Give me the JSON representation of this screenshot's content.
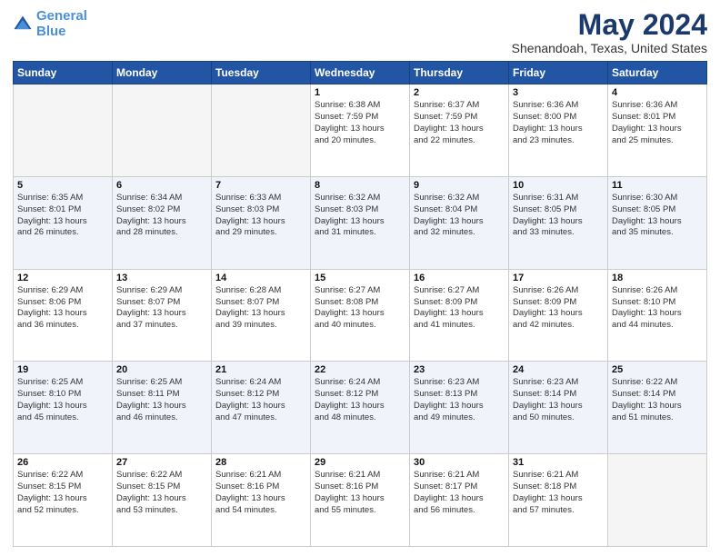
{
  "header": {
    "logo_line1": "General",
    "logo_line2": "Blue",
    "title": "May 2024",
    "subtitle": "Shenandoah, Texas, United States"
  },
  "weekdays": [
    "Sunday",
    "Monday",
    "Tuesday",
    "Wednesday",
    "Thursday",
    "Friday",
    "Saturday"
  ],
  "weeks": [
    [
      {
        "day": "",
        "empty": true
      },
      {
        "day": "",
        "empty": true
      },
      {
        "day": "",
        "empty": true
      },
      {
        "day": "1",
        "sunrise": "6:38 AM",
        "sunset": "7:59 PM",
        "daylight": "13 hours and 20 minutes."
      },
      {
        "day": "2",
        "sunrise": "6:37 AM",
        "sunset": "7:59 PM",
        "daylight": "13 hours and 22 minutes."
      },
      {
        "day": "3",
        "sunrise": "6:36 AM",
        "sunset": "8:00 PM",
        "daylight": "13 hours and 23 minutes."
      },
      {
        "day": "4",
        "sunrise": "6:36 AM",
        "sunset": "8:01 PM",
        "daylight": "13 hours and 25 minutes."
      }
    ],
    [
      {
        "day": "5",
        "sunrise": "6:35 AM",
        "sunset": "8:01 PM",
        "daylight": "13 hours and 26 minutes."
      },
      {
        "day": "6",
        "sunrise": "6:34 AM",
        "sunset": "8:02 PM",
        "daylight": "13 hours and 28 minutes."
      },
      {
        "day": "7",
        "sunrise": "6:33 AM",
        "sunset": "8:03 PM",
        "daylight": "13 hours and 29 minutes."
      },
      {
        "day": "8",
        "sunrise": "6:32 AM",
        "sunset": "8:03 PM",
        "daylight": "13 hours and 31 minutes."
      },
      {
        "day": "9",
        "sunrise": "6:32 AM",
        "sunset": "8:04 PM",
        "daylight": "13 hours and 32 minutes."
      },
      {
        "day": "10",
        "sunrise": "6:31 AM",
        "sunset": "8:05 PM",
        "daylight": "13 hours and 33 minutes."
      },
      {
        "day": "11",
        "sunrise": "6:30 AM",
        "sunset": "8:05 PM",
        "daylight": "13 hours and 35 minutes."
      }
    ],
    [
      {
        "day": "12",
        "sunrise": "6:29 AM",
        "sunset": "8:06 PM",
        "daylight": "13 hours and 36 minutes."
      },
      {
        "day": "13",
        "sunrise": "6:29 AM",
        "sunset": "8:07 PM",
        "daylight": "13 hours and 37 minutes."
      },
      {
        "day": "14",
        "sunrise": "6:28 AM",
        "sunset": "8:07 PM",
        "daylight": "13 hours and 39 minutes."
      },
      {
        "day": "15",
        "sunrise": "6:27 AM",
        "sunset": "8:08 PM",
        "daylight": "13 hours and 40 minutes."
      },
      {
        "day": "16",
        "sunrise": "6:27 AM",
        "sunset": "8:09 PM",
        "daylight": "13 hours and 41 minutes."
      },
      {
        "day": "17",
        "sunrise": "6:26 AM",
        "sunset": "8:09 PM",
        "daylight": "13 hours and 42 minutes."
      },
      {
        "day": "18",
        "sunrise": "6:26 AM",
        "sunset": "8:10 PM",
        "daylight": "13 hours and 44 minutes."
      }
    ],
    [
      {
        "day": "19",
        "sunrise": "6:25 AM",
        "sunset": "8:10 PM",
        "daylight": "13 hours and 45 minutes."
      },
      {
        "day": "20",
        "sunrise": "6:25 AM",
        "sunset": "8:11 PM",
        "daylight": "13 hours and 46 minutes."
      },
      {
        "day": "21",
        "sunrise": "6:24 AM",
        "sunset": "8:12 PM",
        "daylight": "13 hours and 47 minutes."
      },
      {
        "day": "22",
        "sunrise": "6:24 AM",
        "sunset": "8:12 PM",
        "daylight": "13 hours and 48 minutes."
      },
      {
        "day": "23",
        "sunrise": "6:23 AM",
        "sunset": "8:13 PM",
        "daylight": "13 hours and 49 minutes."
      },
      {
        "day": "24",
        "sunrise": "6:23 AM",
        "sunset": "8:14 PM",
        "daylight": "13 hours and 50 minutes."
      },
      {
        "day": "25",
        "sunrise": "6:22 AM",
        "sunset": "8:14 PM",
        "daylight": "13 hours and 51 minutes."
      }
    ],
    [
      {
        "day": "26",
        "sunrise": "6:22 AM",
        "sunset": "8:15 PM",
        "daylight": "13 hours and 52 minutes."
      },
      {
        "day": "27",
        "sunrise": "6:22 AM",
        "sunset": "8:15 PM",
        "daylight": "13 hours and 53 minutes."
      },
      {
        "day": "28",
        "sunrise": "6:21 AM",
        "sunset": "8:16 PM",
        "daylight": "13 hours and 54 minutes."
      },
      {
        "day": "29",
        "sunrise": "6:21 AM",
        "sunset": "8:16 PM",
        "daylight": "13 hours and 55 minutes."
      },
      {
        "day": "30",
        "sunrise": "6:21 AM",
        "sunset": "8:17 PM",
        "daylight": "13 hours and 56 minutes."
      },
      {
        "day": "31",
        "sunrise": "6:21 AM",
        "sunset": "8:18 PM",
        "daylight": "13 hours and 57 minutes."
      },
      {
        "day": "",
        "empty": true
      }
    ]
  ]
}
